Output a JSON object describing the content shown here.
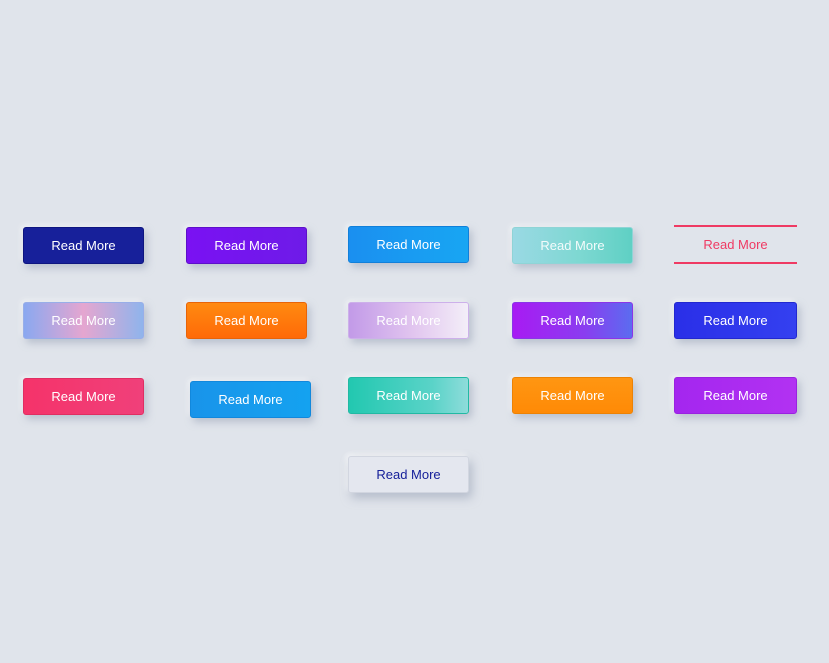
{
  "buttons": [
    {
      "label": "Read More",
      "style": "solid-navy",
      "color": "#17209a"
    },
    {
      "label": "Read More",
      "style": "solid-violet",
      "color": "#7a11f3"
    },
    {
      "label": "Read More",
      "style": "gradient-azure",
      "color": "#1a8ff0"
    },
    {
      "label": "Read More",
      "style": "gradient-mint",
      "color": "#7ed8d2"
    },
    {
      "label": "Read More",
      "style": "outline-lines-pink",
      "color": "#ef3a63"
    },
    {
      "label": "Read More",
      "style": "gradient-pastel-blue-pink",
      "color": "#e5a6d0"
    },
    {
      "label": "Read More",
      "style": "gradient-orange",
      "color": "#ff7a0c"
    },
    {
      "label": "Read More",
      "style": "gradient-lilac-white",
      "color": "#c29ae8"
    },
    {
      "label": "Read More",
      "style": "gradient-purple-blue",
      "color": "#a81bf3"
    },
    {
      "label": "Read More",
      "style": "solid-royal-blue",
      "color": "#2a2fe8"
    },
    {
      "label": "Read More",
      "style": "solid-pink",
      "color": "#f5336a"
    },
    {
      "label": "Read More",
      "style": "solid-sky-blue",
      "color": "#1994ea"
    },
    {
      "label": "Read More",
      "style": "gradient-teal",
      "color": "#22c8b0"
    },
    {
      "label": "Read More",
      "style": "solid-amber",
      "color": "#ff9612"
    },
    {
      "label": "Read More",
      "style": "solid-magenta",
      "color": "#a426ef"
    },
    {
      "label": "Read More",
      "style": "neumorphic-light",
      "color": "#16209a"
    }
  ],
  "colors": {
    "background": "#e0e4eb"
  }
}
